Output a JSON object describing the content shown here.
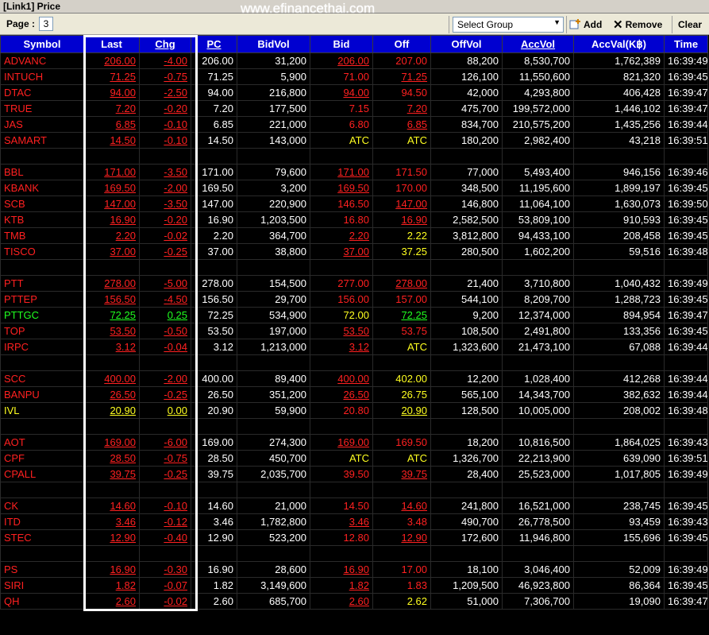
{
  "window": {
    "title": "[Link1] Price",
    "watermark": "www.efinancethai.com"
  },
  "toolbar": {
    "page_label": "Page :",
    "page_value": "3",
    "select_group_placeholder": "Select Group",
    "add_label": "Add",
    "remove_label": "Remove",
    "clear_label": "Clear"
  },
  "colors": {
    "header_bg": "#0000d0",
    "red": "#ff2020",
    "green": "#20ff20",
    "yellow": "#ffff20",
    "white": "#ffffff"
  },
  "columns": [
    "Symbol",
    "Last",
    "Chg",
    "PC",
    "BidVol",
    "Bid",
    "Off",
    "OffVol",
    "AccVol",
    "AccVal(K฿)",
    "Time"
  ],
  "rows": [
    {
      "sym": "ADVANC",
      "last": "206.00",
      "chg": "-4.00",
      "pc": "206.00",
      "bidvol": "31,200",
      "bid": "206.00",
      "off": "207.00",
      "offvol": "88,200",
      "accvol": "8,530,700",
      "accval": "1,762,389",
      "time": "16:39:49",
      "c": "red",
      "bidc": "red",
      "offc": "red",
      "bidu": true,
      "offu": false
    },
    {
      "sym": "INTUCH",
      "last": "71.25",
      "chg": "-0.75",
      "pc": "71.25",
      "bidvol": "5,900",
      "bid": "71.00",
      "off": "71.25",
      "offvol": "126,100",
      "accvol": "11,550,600",
      "accval": "821,320",
      "time": "16:39:45",
      "c": "red",
      "bidc": "red",
      "offc": "red",
      "bidu": false,
      "offu": true
    },
    {
      "sym": "DTAC",
      "last": "94.00",
      "chg": "-2.50",
      "pc": "94.00",
      "bidvol": "216,800",
      "bid": "94.00",
      "off": "94.50",
      "offvol": "42,000",
      "accvol": "4,293,800",
      "accval": "406,428",
      "time": "16:39:47",
      "c": "red",
      "bidc": "red",
      "offc": "red",
      "bidu": true,
      "offu": false
    },
    {
      "sym": "TRUE",
      "last": "7.20",
      "chg": "-0.20",
      "pc": "7.20",
      "bidvol": "177,500",
      "bid": "7.15",
      "off": "7.20",
      "offvol": "475,700",
      "accvol": "199,572,000",
      "accval": "1,446,102",
      "time": "16:39:47",
      "c": "red",
      "bidc": "red",
      "offc": "red",
      "bidu": false,
      "offu": true
    },
    {
      "sym": "JAS",
      "last": "6.85",
      "chg": "-0.10",
      "pc": "6.85",
      "bidvol": "221,000",
      "bid": "6.80",
      "off": "6.85",
      "offvol": "834,700",
      "accvol": "210,575,200",
      "accval": "1,435,256",
      "time": "16:39:44",
      "c": "red",
      "bidc": "red",
      "offc": "red",
      "bidu": false,
      "offu": true
    },
    {
      "sym": "SAMART",
      "last": "14.50",
      "chg": "-0.10",
      "pc": "14.50",
      "bidvol": "143,000",
      "bid": "ATC",
      "off": "ATC",
      "offvol": "180,200",
      "accvol": "2,982,400",
      "accval": "43,218",
      "time": "16:39:51",
      "c": "red",
      "bidc": "yellow",
      "offc": "yellow",
      "bidu": false,
      "offu": false
    },
    {
      "blank": true
    },
    {
      "sym": "BBL",
      "last": "171.00",
      "chg": "-3.50",
      "pc": "171.00",
      "bidvol": "79,600",
      "bid": "171.00",
      "off": "171.50",
      "offvol": "77,000",
      "accvol": "5,493,400",
      "accval": "946,156",
      "time": "16:39:46",
      "c": "red",
      "bidc": "red",
      "offc": "red",
      "bidu": true,
      "offu": false
    },
    {
      "sym": "KBANK",
      "last": "169.50",
      "chg": "-2.00",
      "pc": "169.50",
      "bidvol": "3,200",
      "bid": "169.50",
      "off": "170.00",
      "offvol": "348,500",
      "accvol": "11,195,600",
      "accval": "1,899,197",
      "time": "16:39:45",
      "c": "red",
      "bidc": "red",
      "offc": "red",
      "bidu": true,
      "offu": false
    },
    {
      "sym": "SCB",
      "last": "147.00",
      "chg": "-3.50",
      "pc": "147.00",
      "bidvol": "220,900",
      "bid": "146.50",
      "off": "147.00",
      "offvol": "146,800",
      "accvol": "11,064,100",
      "accval": "1,630,073",
      "time": "16:39:50",
      "c": "red",
      "bidc": "red",
      "offc": "red",
      "bidu": false,
      "offu": true
    },
    {
      "sym": "KTB",
      "last": "16.90",
      "chg": "-0.20",
      "pc": "16.90",
      "bidvol": "1,203,500",
      "bid": "16.80",
      "off": "16.90",
      "offvol": "2,582,500",
      "accvol": "53,809,100",
      "accval": "910,593",
      "time": "16:39:45",
      "c": "red",
      "bidc": "red",
      "offc": "red",
      "bidu": false,
      "offu": true
    },
    {
      "sym": "TMB",
      "last": "2.20",
      "chg": "-0.02",
      "pc": "2.20",
      "bidvol": "364,700",
      "bid": "2.20",
      "off": "2.22",
      "offvol": "3,812,800",
      "accvol": "94,433,100",
      "accval": "208,458",
      "time": "16:39:45",
      "c": "red",
      "bidc": "red",
      "offc": "yellow",
      "bidu": true,
      "offu": false
    },
    {
      "sym": "TISCO",
      "last": "37.00",
      "chg": "-0.25",
      "pc": "37.00",
      "bidvol": "38,800",
      "bid": "37.00",
      "off": "37.25",
      "offvol": "280,500",
      "accvol": "1,602,200",
      "accval": "59,516",
      "time": "16:39:48",
      "c": "red",
      "bidc": "red",
      "offc": "yellow",
      "bidu": true,
      "offu": false
    },
    {
      "blank": true
    },
    {
      "sym": "PTT",
      "last": "278.00",
      "chg": "-5.00",
      "pc": "278.00",
      "bidvol": "154,500",
      "bid": "277.00",
      "off": "278.00",
      "offvol": "21,400",
      "accvol": "3,710,800",
      "accval": "1,040,432",
      "time": "16:39:49",
      "c": "red",
      "bidc": "red",
      "offc": "red",
      "bidu": false,
      "offu": true
    },
    {
      "sym": "PTTEP",
      "last": "156.50",
      "chg": "-4.50",
      "pc": "156.50",
      "bidvol": "29,700",
      "bid": "156.00",
      "off": "157.00",
      "offvol": "544,100",
      "accvol": "8,209,700",
      "accval": "1,288,723",
      "time": "16:39:45",
      "c": "red",
      "bidc": "red",
      "offc": "red",
      "bidu": false,
      "offu": false
    },
    {
      "sym": "PTTGC",
      "last": "72.25",
      "chg": "0.25",
      "pc": "72.25",
      "bidvol": "534,900",
      "bid": "72.00",
      "off": "72.25",
      "offvol": "9,200",
      "accvol": "12,374,000",
      "accval": "894,954",
      "time": "16:39:47",
      "c": "green",
      "bidc": "yellow",
      "offc": "green",
      "bidu": false,
      "offu": true
    },
    {
      "sym": "TOP",
      "last": "53.50",
      "chg": "-0.50",
      "pc": "53.50",
      "bidvol": "197,000",
      "bid": "53.50",
      "off": "53.75",
      "offvol": "108,500",
      "accvol": "2,491,800",
      "accval": "133,356",
      "time": "16:39:45",
      "c": "red",
      "bidc": "red",
      "offc": "red",
      "bidu": true,
      "offu": false
    },
    {
      "sym": "IRPC",
      "last": "3.12",
      "chg": "-0.04",
      "pc": "3.12",
      "bidvol": "1,213,000",
      "bid": "3.12",
      "off": "ATC",
      "offvol": "1,323,600",
      "accvol": "21,473,100",
      "accval": "67,088",
      "time": "16:39:44",
      "c": "red",
      "bidc": "red",
      "offc": "yellow",
      "bidu": true,
      "offu": false
    },
    {
      "blank": true
    },
    {
      "sym": "SCC",
      "last": "400.00",
      "chg": "-2.00",
      "pc": "400.00",
      "bidvol": "89,400",
      "bid": "400.00",
      "off": "402.00",
      "offvol": "12,200",
      "accvol": "1,028,400",
      "accval": "412,268",
      "time": "16:39:44",
      "c": "red",
      "bidc": "red",
      "offc": "yellow",
      "bidu": true,
      "offu": false
    },
    {
      "sym": "BANPU",
      "last": "26.50",
      "chg": "-0.25",
      "pc": "26.50",
      "bidvol": "351,200",
      "bid": "26.50",
      "off": "26.75",
      "offvol": "565,100",
      "accvol": "14,343,700",
      "accval": "382,632",
      "time": "16:39:44",
      "c": "red",
      "bidc": "red",
      "offc": "yellow",
      "bidu": true,
      "offu": false
    },
    {
      "sym": "IVL",
      "last": "20.90",
      "chg": "0.00",
      "pc": "20.90",
      "bidvol": "59,900",
      "bid": "20.80",
      "off": "20.90",
      "offvol": "128,500",
      "accvol": "10,005,000",
      "accval": "208,002",
      "time": "16:39:48",
      "c": "yellow",
      "bidc": "red",
      "offc": "yellow",
      "bidu": false,
      "offu": true
    },
    {
      "blank": true
    },
    {
      "sym": "AOT",
      "last": "169.00",
      "chg": "-6.00",
      "pc": "169.00",
      "bidvol": "274,300",
      "bid": "169.00",
      "off": "169.50",
      "offvol": "18,200",
      "accvol": "10,816,500",
      "accval": "1,864,025",
      "time": "16:39:43",
      "c": "red",
      "bidc": "red",
      "offc": "red",
      "bidu": true,
      "offu": false
    },
    {
      "sym": "CPF",
      "last": "28.50",
      "chg": "-0.75",
      "pc": "28.50",
      "bidvol": "450,700",
      "bid": "ATC",
      "off": "ATC",
      "offvol": "1,326,700",
      "accvol": "22,213,900",
      "accval": "639,090",
      "time": "16:39:51",
      "c": "red",
      "bidc": "yellow",
      "offc": "yellow",
      "bidu": false,
      "offu": false
    },
    {
      "sym": "CPALL",
      "last": "39.75",
      "chg": "-0.25",
      "pc": "39.75",
      "bidvol": "2,035,700",
      "bid": "39.50",
      "off": "39.75",
      "offvol": "28,400",
      "accvol": "25,523,000",
      "accval": "1,017,805",
      "time": "16:39:49",
      "c": "red",
      "bidc": "red",
      "offc": "red",
      "bidu": false,
      "offu": true
    },
    {
      "blank": true
    },
    {
      "sym": "CK",
      "last": "14.60",
      "chg": "-0.10",
      "pc": "14.60",
      "bidvol": "21,000",
      "bid": "14.50",
      "off": "14.60",
      "offvol": "241,800",
      "accvol": "16,521,000",
      "accval": "238,745",
      "time": "16:39:45",
      "c": "red",
      "bidc": "red",
      "offc": "red",
      "bidu": false,
      "offu": true
    },
    {
      "sym": "ITD",
      "last": "3.46",
      "chg": "-0.12",
      "pc": "3.46",
      "bidvol": "1,782,800",
      "bid": "3.46",
      "off": "3.48",
      "offvol": "490,700",
      "accvol": "26,778,500",
      "accval": "93,459",
      "time": "16:39:43",
      "c": "red",
      "bidc": "red",
      "offc": "red",
      "bidu": true,
      "offu": false
    },
    {
      "sym": "STEC",
      "last": "12.90",
      "chg": "-0.40",
      "pc": "12.90",
      "bidvol": "523,200",
      "bid": "12.80",
      "off": "12.90",
      "offvol": "172,600",
      "accvol": "11,946,800",
      "accval": "155,696",
      "time": "16:39:45",
      "c": "red",
      "bidc": "red",
      "offc": "red",
      "bidu": false,
      "offu": true
    },
    {
      "blank": true
    },
    {
      "sym": "PS",
      "last": "16.90",
      "chg": "-0.30",
      "pc": "16.90",
      "bidvol": "28,600",
      "bid": "16.90",
      "off": "17.00",
      "offvol": "18,100",
      "accvol": "3,046,400",
      "accval": "52,009",
      "time": "16:39:49",
      "c": "red",
      "bidc": "red",
      "offc": "red",
      "bidu": true,
      "offu": false
    },
    {
      "sym": "SIRI",
      "last": "1.82",
      "chg": "-0.07",
      "pc": "1.82",
      "bidvol": "3,149,600",
      "bid": "1.82",
      "off": "1.83",
      "offvol": "1,209,500",
      "accvol": "46,923,800",
      "accval": "86,364",
      "time": "16:39:45",
      "c": "red",
      "bidc": "red",
      "offc": "red",
      "bidu": true,
      "offu": false
    },
    {
      "sym": "QH",
      "last": "2.60",
      "chg": "-0.02",
      "pc": "2.60",
      "bidvol": "685,700",
      "bid": "2.60",
      "off": "2.62",
      "offvol": "51,000",
      "accvol": "7,306,700",
      "accval": "19,090",
      "time": "16:39:47",
      "c": "red",
      "bidc": "red",
      "offc": "yellow",
      "bidu": true,
      "offu": false
    }
  ]
}
